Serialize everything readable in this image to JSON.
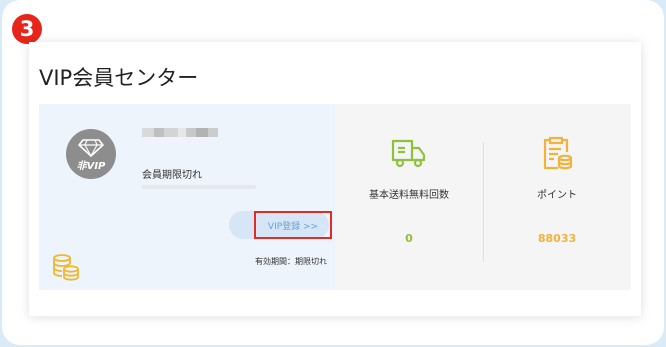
{
  "step": {
    "number": "3"
  },
  "card": {
    "title": "VIP会員センター"
  },
  "membership": {
    "badge_text": "非VIP",
    "status": "会員期限切れ",
    "progress": 0,
    "vip_button": "VIP登録 >>",
    "validity": "有効期間：期限切れ"
  },
  "stats": [
    {
      "label": "基本送料無料回数",
      "value": "0",
      "icon": "truck-icon",
      "color": "#8ec23c"
    },
    {
      "label": "ポイント",
      "value": "88033",
      "icon": "clipboard-coins-icon",
      "color": "#f2b23c"
    }
  ],
  "colors": {
    "step_badge": "#e8251a",
    "highlight_border": "#e32b22",
    "vip_text": "#6aa2d8",
    "coin_icon": "#f0b82d"
  },
  "icons": {
    "avatar": "diamond-vip-icon",
    "coins": "coins-stack-icon"
  }
}
